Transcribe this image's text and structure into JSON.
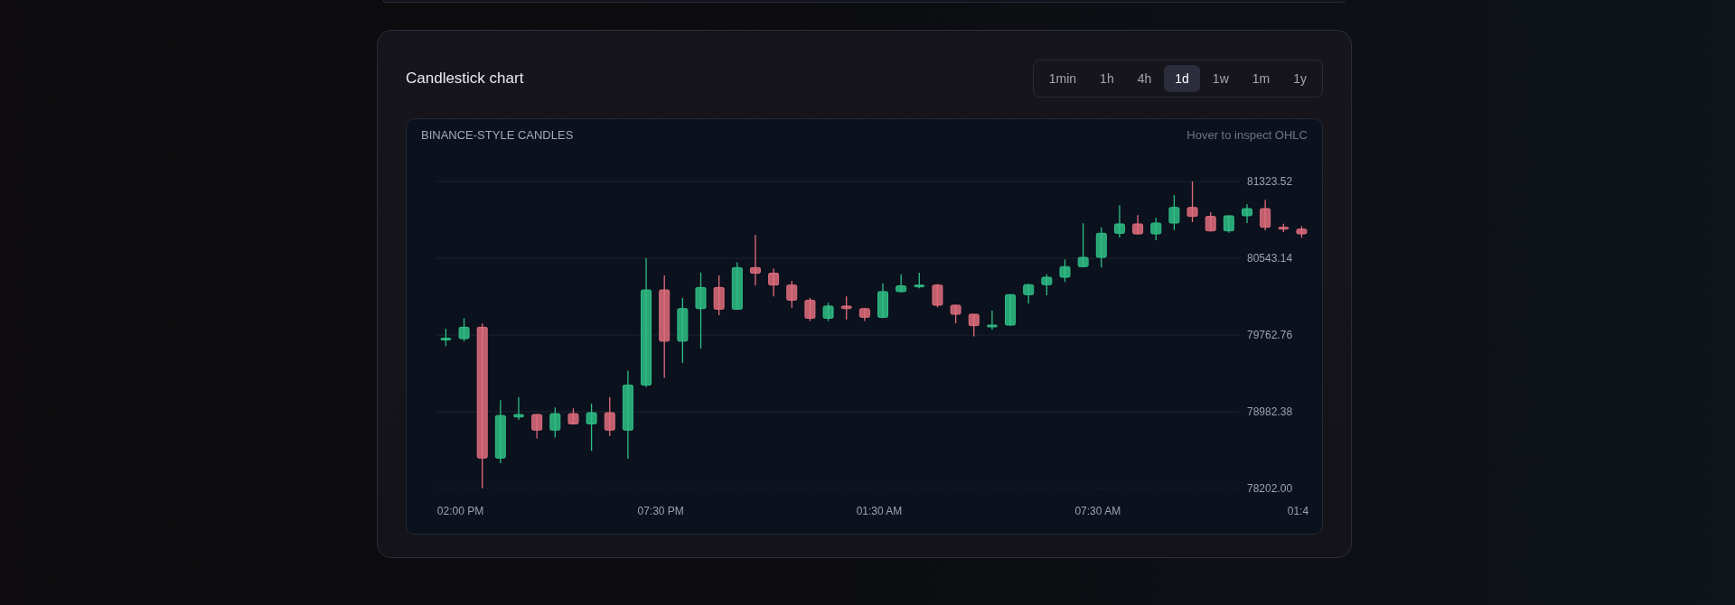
{
  "card": {
    "title": "Candlestick chart"
  },
  "timeframes": [
    {
      "label": "1min",
      "selected": false
    },
    {
      "label": "1h",
      "selected": false
    },
    {
      "label": "4h",
      "selected": false
    },
    {
      "label": "1d",
      "selected": true
    },
    {
      "label": "1w",
      "selected": false
    },
    {
      "label": "1m",
      "selected": false
    },
    {
      "label": "1y",
      "selected": false
    }
  ],
  "chart": {
    "label": "BINANCE-STYLE CANDLES",
    "hint": "Hover to inspect OHLC",
    "chart_data": {
      "type": "candlestick",
      "categories": [
        null,
        "02:00 PM",
        null,
        null,
        null,
        null,
        null,
        null,
        null,
        null,
        null,
        null,
        "07:30 PM",
        null,
        null,
        null,
        null,
        null,
        null,
        null,
        null,
        null,
        null,
        null,
        "01:30 AM",
        null,
        null,
        null,
        null,
        null,
        null,
        null,
        null,
        null,
        null,
        null,
        "07:30 AM",
        null,
        null,
        null,
        null,
        null,
        null,
        null,
        null,
        null,
        null,
        "01:4"
      ],
      "ohlc": [
        [
          79712,
          79826,
          79649,
          79731
        ],
        [
          79725,
          79933,
          79700,
          79842
        ],
        [
          79842,
          79880,
          78205,
          78512
        ],
        [
          78512,
          79099,
          78458,
          78944
        ],
        [
          78929,
          79131,
          78900,
          78954
        ],
        [
          78954,
          78960,
          78711,
          78796
        ],
        [
          78796,
          79027,
          78720,
          78963
        ],
        [
          78963,
          79017,
          78859,
          78859
        ],
        [
          78859,
          79065,
          78584,
          78973
        ],
        [
          78973,
          79131,
          78736,
          78796
        ],
        [
          78796,
          79399,
          78505,
          79254
        ],
        [
          79254,
          80543,
          79232,
          80221
        ],
        [
          80221,
          80369,
          79327,
          79700
        ],
        [
          79700,
          80139,
          79478,
          80031
        ],
        [
          80031,
          80398,
          79624,
          80246
        ],
        [
          80246,
          80369,
          79965,
          80025
        ],
        [
          80025,
          80502,
          80020,
          80448
        ],
        [
          80448,
          80780,
          80265,
          80391
        ],
        [
          80391,
          80439,
          80155,
          80271
        ],
        [
          80271,
          80313,
          80038,
          80117
        ],
        [
          80117,
          80139,
          79905,
          79933
        ],
        [
          79933,
          80091,
          79905,
          80057
        ],
        [
          80057,
          80155,
          79921,
          80031
        ],
        [
          80031,
          80038,
          79905,
          79943
        ],
        [
          79943,
          80289,
          79934,
          80204
        ],
        [
          80204,
          80381,
          80198,
          80262
        ],
        [
          80256,
          80396,
          80237,
          80271
        ],
        [
          80271,
          80280,
          80044,
          80066
        ],
        [
          80066,
          80070,
          79882,
          79974
        ],
        [
          79974,
          79977,
          79748,
          79858
        ],
        [
          79846,
          80011,
          79815,
          79864
        ],
        [
          79864,
          80179,
          79858,
          80173
        ],
        [
          80173,
          80283,
          80084,
          80274
        ],
        [
          80274,
          80381,
          80167,
          80350
        ],
        [
          80350,
          80531,
          80302,
          80458
        ],
        [
          80458,
          80898,
          80455,
          80552
        ],
        [
          80552,
          80858,
          80450,
          80797
        ],
        [
          80797,
          81082,
          80754,
          80892
        ],
        [
          80892,
          80981,
          80785,
          80791
        ],
        [
          80791,
          80953,
          80727,
          80901
        ],
        [
          80901,
          81186,
          80831,
          81060
        ],
        [
          81060,
          81323.52,
          80910,
          80969
        ],
        [
          80969,
          81011,
          80813,
          80822
        ],
        [
          80822,
          80978,
          80803,
          80975
        ],
        [
          80975,
          81091,
          80901,
          81048
        ],
        [
          81048,
          81137,
          80828,
          80858
        ],
        [
          80858,
          80895,
          80809,
          80840
        ],
        [
          80840,
          80868,
          80751,
          80791
        ]
      ],
      "grid": true,
      "ylim": [
        78202,
        81323.52
      ],
      "yticks": [
        {
          "value": 81323.52,
          "label": "81323.52"
        },
        {
          "value": 80543.14,
          "label": "80543.14"
        },
        {
          "value": 79762.76,
          "label": "79762.76"
        },
        {
          "value": 78982.38,
          "label": "78982.38"
        },
        {
          "value": 78202,
          "label": "78202.00"
        }
      ]
    }
  }
}
